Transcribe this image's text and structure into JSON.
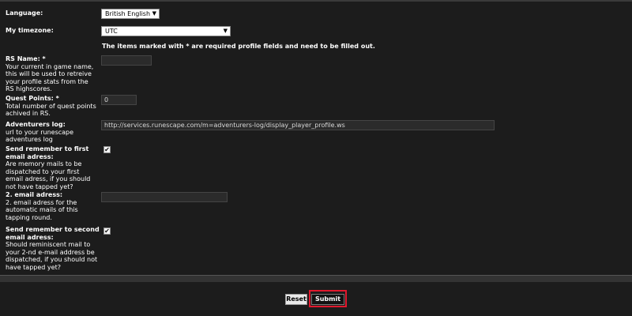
{
  "form": {
    "language": {
      "label": "Language:",
      "value": "British English"
    },
    "timezone": {
      "label": "My timezone:",
      "value": "UTC"
    },
    "required_note": "The items marked with * are required profile fields and need to be filled out.",
    "rs_name": {
      "label": "RS Name: *",
      "desc": [
        "Your current in game name,",
        "this will be used to retreive",
        "your profile stats from the",
        "RS highscores."
      ],
      "value": ""
    },
    "quest_points": {
      "label": "Quest Points: *",
      "desc": [
        "Total number of quest points",
        "achived in RS."
      ],
      "value": "0"
    },
    "adventurers_log": {
      "label": "Adventurers log:",
      "desc": [
        "url to your runescape",
        "adventures log"
      ],
      "value": "http://services.runescape.com/m=adventurers-log/display_player_profile.ws"
    },
    "first_email": {
      "label_lines": [
        "Send remember to first",
        "email adress:"
      ],
      "desc": [
        "Are memory mails to be",
        "dispatched to your first",
        "email adress, if you should",
        "not have tapped yet?"
      ],
      "checked": true,
      "check_glyph": "✔"
    },
    "second_email_address": {
      "label": "2. email adress:",
      "desc": [
        "2. email adress for the",
        "automatic mails of this",
        "tapping round."
      ],
      "value": ""
    },
    "second_email": {
      "label_lines": [
        "Send remember to second",
        "email adress:"
      ],
      "desc": [
        "Should reminiscent mail to",
        "your 2-nd e-mail address be",
        "dispatched, if you should not",
        "have tapped yet?"
      ],
      "checked": true,
      "check_glyph": "✔"
    }
  },
  "buttons": {
    "reset": "Reset",
    "submit": "Submit"
  },
  "icons": {
    "dropdown": "chevron-down-icon",
    "arrow_glyph": "▼"
  },
  "colors": {
    "background": "#1c1c1c",
    "highlight": "#e0182d"
  }
}
